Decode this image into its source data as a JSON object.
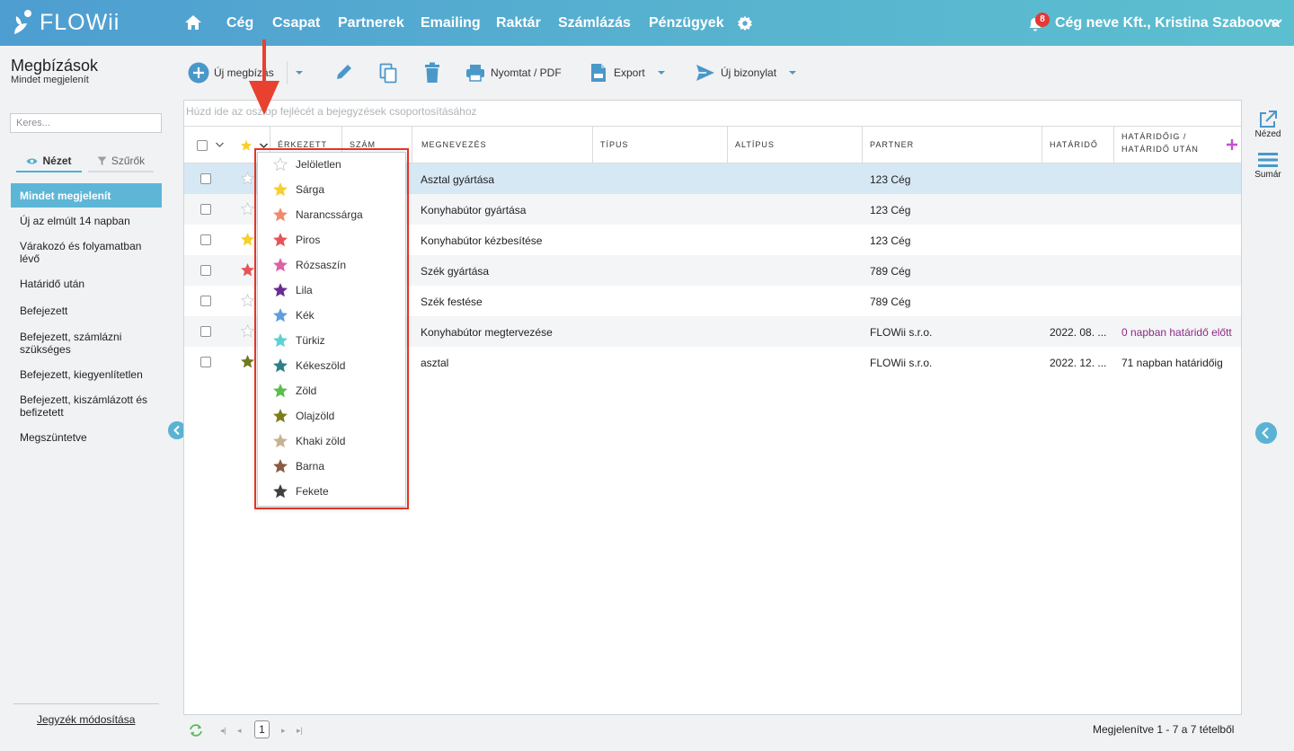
{
  "app": {
    "logo_text": "FLOWii"
  },
  "nav": {
    "items": [
      "Cég",
      "Csapat",
      "Partnerek",
      "Emailing",
      "Raktár",
      "Számlázás",
      "Pénzügyek"
    ],
    "notification_count": "8",
    "account": "Cég neve Kft., Kristina Szaboova"
  },
  "page": {
    "title": "Megbízások",
    "subtitle": "Mindet megjelenít"
  },
  "search": {
    "placeholder": "Keres..."
  },
  "left_tabs": {
    "view": "Nézet",
    "filters": "Szűrők"
  },
  "views": [
    "Mindet megjelenít",
    "Új az elmúlt 14 napban",
    "Várakozó és folyamatban lévő",
    "Határidő után",
    "Befejezett",
    "Befejezett, számlázni szükséges",
    "Befejezett, kiegyenlítetlen",
    "Befejezett, kiszámlázott és befizetett",
    "Megszüntetve"
  ],
  "left_footer": {
    "edit_list": "Jegyzék módosítása"
  },
  "toolbar": {
    "new_order": "Új megbízás",
    "print": "Nyomtat / PDF",
    "export": "Export",
    "new_document": "Új bizonylat"
  },
  "right_panel": {
    "view_label": "Nézed",
    "summary_label": "Sumár"
  },
  "grid": {
    "group_hint": "Húzd ide az oszlop fejlécét a bejegyzések csoportosításához",
    "columns": [
      "ÉRKEZETT",
      "SZÁM",
      "MEGNEVEZÉS",
      "TÍPUS",
      "ALTÍPUS",
      "PARTNER",
      "HATÁRIDŐ",
      "HATÁRIDŐIG / HATÁRIDŐ UTÁN"
    ],
    "rows": [
      {
        "name": "Asztal gyártása",
        "partner": "123 Cég",
        "deadline": "",
        "status": "",
        "star": "#ffffff"
      },
      {
        "name": "Konyhabútor gyártása",
        "partner": "123 Cég",
        "deadline": "",
        "status": "",
        "star": "#ffffff"
      },
      {
        "name": "Konyhabútor kézbesítése",
        "partner": "123 Cég",
        "deadline": "",
        "status": "",
        "star": "#f7cf2e"
      },
      {
        "name": "Szék gyártása",
        "partner": "789 Cég",
        "deadline": "",
        "status": "",
        "star": "#e5545a"
      },
      {
        "name": "Szék festése",
        "partner": "789 Cég",
        "deadline": "",
        "status": "",
        "star": "#ffffff"
      },
      {
        "name": "Konyhabútor megtervezése",
        "partner": "FLOWii s.r.o.",
        "deadline": "2022. 08. ...",
        "status": "0 napban határidő előtt",
        "star": "#ffffff"
      },
      {
        "name": "asztal",
        "partner": "FLOWii s.r.o.",
        "deadline": "2022. 12. ...",
        "status": "71 napban határidőig",
        "star": "#6f7a1e"
      }
    ],
    "status_colors": {
      "before_deadline": "#8e2a8b",
      "normal": "#222222"
    }
  },
  "star_menu": [
    {
      "label": "Jelöletlen",
      "color": "#ffffff"
    },
    {
      "label": "Sárga",
      "color": "#f7cf2e"
    },
    {
      "label": "Narancssárga",
      "color": "#f08a6a"
    },
    {
      "label": "Piros",
      "color": "#e5545a"
    },
    {
      "label": "Rózsaszín",
      "color": "#e05fa5"
    },
    {
      "label": "Lila",
      "color": "#6a2c91"
    },
    {
      "label": "Kék",
      "color": "#5d9ee0"
    },
    {
      "label": "Türkiz",
      "color": "#5fd0d0"
    },
    {
      "label": "Kékeszöld",
      "color": "#2e7f86"
    },
    {
      "label": "Zöld",
      "color": "#5cbc4c"
    },
    {
      "label": "Olajzöld",
      "color": "#7d7d1f"
    },
    {
      "label": "Khaki zöld",
      "color": "#c9b28f"
    },
    {
      "label": "Barna",
      "color": "#8b5a42"
    },
    {
      "label": "Fekete",
      "color": "#3d3f42"
    }
  ],
  "pagination": {
    "page": "1",
    "info": "Megjelenítve 1 - 7 a 7 tételből"
  },
  "accent_color": "#5db6d6"
}
